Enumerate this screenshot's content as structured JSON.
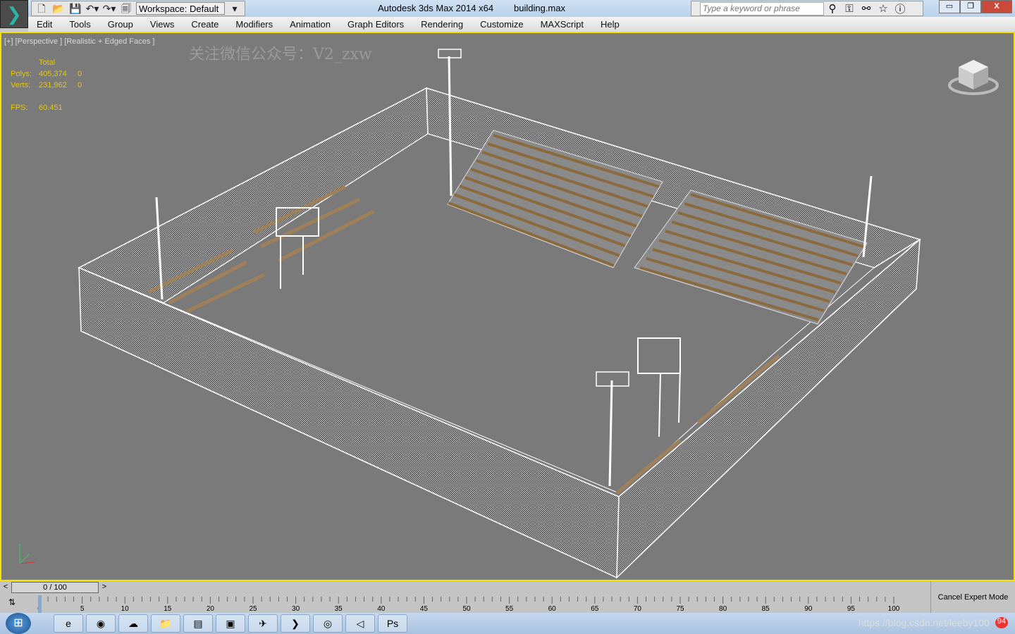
{
  "titlebar": {
    "app_title": "Autodesk 3ds Max  2014 x64",
    "file": "building.max",
    "workspace": "Workspace: Default",
    "search_placeholder": "Type a keyword or phrase"
  },
  "menu": [
    "Edit",
    "Tools",
    "Group",
    "Views",
    "Create",
    "Modifiers",
    "Animation",
    "Graph Editors",
    "Rendering",
    "Customize",
    "MAXScript",
    "Help"
  ],
  "viewport": {
    "label": "[+] [Perspective ] [Realistic + Edged Faces ]",
    "watermark": "关注微信公众号：V2_zxw",
    "stats": {
      "header": "Total",
      "polys_label": "Polys:",
      "polys": "405,374",
      "polys_sel": "0",
      "verts_label": "Verts:",
      "verts": "231,962",
      "verts_sel": "0",
      "fps_label": "FPS:",
      "fps": "60.451"
    },
    "border_color": "#f4e300",
    "bg_color": "#7a7a7a"
  },
  "timeline": {
    "slider": "0 / 100",
    "prev": "<",
    "next": ">",
    "ticks": [
      "0",
      "5",
      "10",
      "15",
      "20",
      "25",
      "30",
      "35",
      "40",
      "45",
      "50",
      "55",
      "60",
      "65",
      "70",
      "75",
      "80",
      "85",
      "90",
      "95",
      "100"
    ],
    "current_frame": 0,
    "total_frames": 100
  },
  "expert_mode": "Cancel Expert Mode",
  "taskbar": {
    "apps": [
      "ie-icon",
      "chrome-icon",
      "baidu-icon",
      "explorer-icon",
      "winrar-icon",
      "iqiyi-icon",
      "feishu-icon",
      "3dsmax-icon",
      "vmware-icon",
      "unity-icon",
      "photoshop-icon"
    ],
    "tray_text": "https://blog.csdn.net/leeby100",
    "badge": "94"
  }
}
